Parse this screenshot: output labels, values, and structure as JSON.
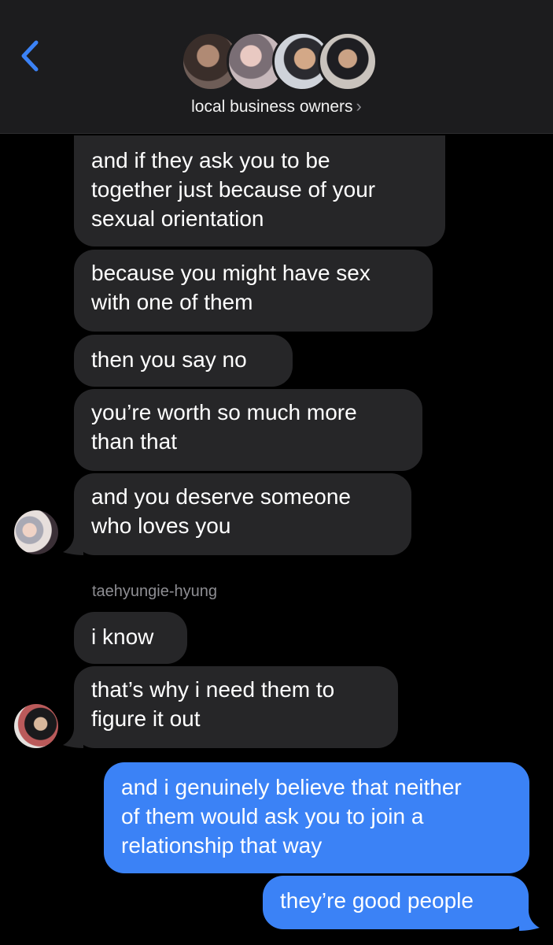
{
  "header": {
    "title": "local business owners",
    "title_chevron": "›",
    "back_icon": "chevron-left-icon",
    "accent_color": "#3b82f6"
  },
  "messages": [
    {
      "direction": "incoming",
      "text_lines": [
        "and if they ask you to be",
        "together just because of your",
        "sexual orientation"
      ]
    },
    {
      "direction": "incoming",
      "text_lines": [
        "because you might have sex",
        "with one of them"
      ]
    },
    {
      "direction": "incoming",
      "text_lines": [
        "then you say no"
      ]
    },
    {
      "direction": "incoming",
      "text_lines": [
        "you’re worth so much more",
        "than that"
      ]
    },
    {
      "direction": "incoming",
      "text_lines": [
        "and you deserve someone",
        "who loves you"
      ]
    },
    {
      "sender": "taehyungie-hyung"
    },
    {
      "direction": "incoming",
      "text_lines": [
        "i know"
      ]
    },
    {
      "direction": "incoming",
      "text_lines": [
        "that’s why i need them to",
        "figure it out"
      ]
    },
    {
      "direction": "outgoing",
      "text_lines": [
        "and i genuinely believe that neither",
        "of them would ask you to join a",
        "relationship that way"
      ]
    },
    {
      "direction": "outgoing",
      "text_lines": [
        "they’re good people"
      ]
    }
  ]
}
